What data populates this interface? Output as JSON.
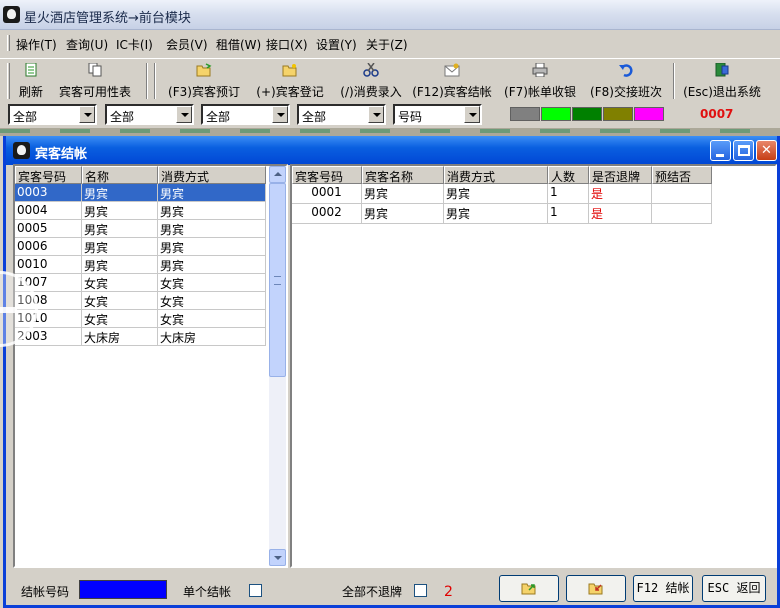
{
  "app": {
    "title": "星火酒店管理系统→前台模块"
  },
  "menu": {
    "items": [
      "操作(T)",
      "查询(U)",
      "IC卡(I)",
      "会员(V)",
      "租借(W)",
      "接口(X)",
      "设置(Y)",
      "关于(Z)"
    ]
  },
  "toolbar": {
    "buttons": [
      {
        "label": "刷新",
        "icon": "refresh-icon"
      },
      {
        "label": "宾客可用性表",
        "icon": "copy-icon"
      },
      {
        "label": "(F3)宾客预订",
        "icon": "open-folder-icon"
      },
      {
        "label": "(+)宾客登记",
        "icon": "folder-icon"
      },
      {
        "label": "(/)消费录入",
        "icon": "scissors-icon"
      },
      {
        "label": "(F12)宾客结帐",
        "icon": "mail-icon"
      },
      {
        "label": "(F7)帐单收银",
        "icon": "printer-icon"
      },
      {
        "label": "(F8)交接班次",
        "icon": "undo-icon"
      },
      {
        "label": "(Esc)退出系统",
        "icon": "exit-icon"
      }
    ]
  },
  "filters": {
    "combos": [
      "全部",
      "全部",
      "全部",
      "全部",
      "号码"
    ],
    "swatches": [
      "#808080",
      "#00ff00",
      "#008000",
      "#808000",
      "#ff00ff"
    ],
    "counter": "0007"
  },
  "dialog": {
    "title": "宾客结帐",
    "left_grid": {
      "columns": [
        "宾客号码",
        "名称",
        "消费方式"
      ],
      "rows": [
        [
          "0003",
          "男宾",
          "男宾"
        ],
        [
          "0004",
          "男宾",
          "男宾"
        ],
        [
          "0005",
          "男宾",
          "男宾"
        ],
        [
          "0006",
          "男宾",
          "男宾"
        ],
        [
          "0010",
          "男宾",
          "男宾"
        ],
        [
          "1007",
          "女宾",
          "女宾"
        ],
        [
          "1008",
          "女宾",
          "女宾"
        ],
        [
          "1010",
          "女宾",
          "女宾"
        ],
        [
          "2003",
          "大床房",
          "大床房"
        ]
      ]
    },
    "right_grid": {
      "columns": [
        "宾客号码",
        "宾客名称",
        "消费方式",
        "人数",
        "是否退牌",
        "预结否"
      ],
      "rows": [
        [
          "0001",
          "男宾",
          "男宾",
          "1",
          "是",
          ""
        ],
        [
          "0002",
          "男宾",
          "男宾",
          "1",
          "是",
          ""
        ]
      ]
    },
    "bottom": {
      "batch_label": "结帐号码",
      "single_label": "单个结帐",
      "all_label": "全部不退牌",
      "count": "2",
      "checkout_button": "F12 结帐",
      "return_button": "ESC 返回"
    }
  }
}
